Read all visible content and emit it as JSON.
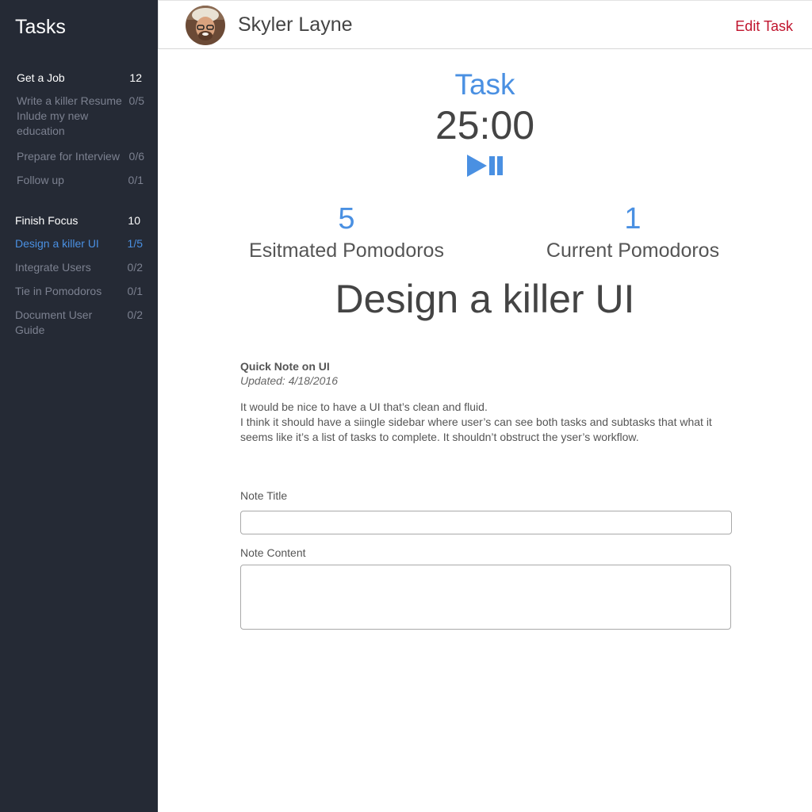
{
  "sidebar": {
    "title": "Tasks",
    "groups": [
      {
        "label": "Get a Job",
        "count": "12",
        "items": [
          {
            "label": "Write a killer Resume Inlude my new education",
            "count": "0/5"
          },
          {
            "label": "Prepare for Interview",
            "count": "0/6"
          },
          {
            "label": "Follow up",
            "count": "0/1"
          }
        ]
      },
      {
        "label": "Finish Focus",
        "count": "10",
        "items": [
          {
            "label": "Design a killer UI",
            "count": "1/5",
            "active": true
          },
          {
            "label": "Integrate Users",
            "count": "0/2"
          },
          {
            "label": "Tie in Pomodoros",
            "count": "0/1"
          },
          {
            "label": "Document User Guide",
            "count": "0/2"
          }
        ]
      }
    ]
  },
  "header": {
    "user_name": "Skyler Layne",
    "edit_label": "Edit Task"
  },
  "timer": {
    "label": "Task",
    "time": "25:00",
    "play_icon": "play-icon",
    "pause_icon": "pause-icon"
  },
  "stats": {
    "estimated": {
      "value": "5",
      "label": "Esitmated Pomodoros"
    },
    "current": {
      "value": "1",
      "label": "Current Pomodoros"
    }
  },
  "task_title": "Design a killer UI",
  "note": {
    "title": "Quick Note on UI",
    "updated": "Updated: 4/18/2016",
    "line1": "It would be nice to have a UI that’s clean and fluid.",
    "line2": "I think it should have a siingle sidebar where user’s can see both tasks and subtasks that what it seems like it’s a list of tasks to complete. It shouldn’t obstruct the yser’s workflow."
  },
  "form": {
    "note_title_label": "Note Title",
    "note_title_value": "",
    "note_content_label": "Note Content",
    "note_content_value": ""
  },
  "colors": {
    "sidebar_bg": "#252a35",
    "accent": "#4a90e2",
    "edit_red": "#c0142d"
  }
}
